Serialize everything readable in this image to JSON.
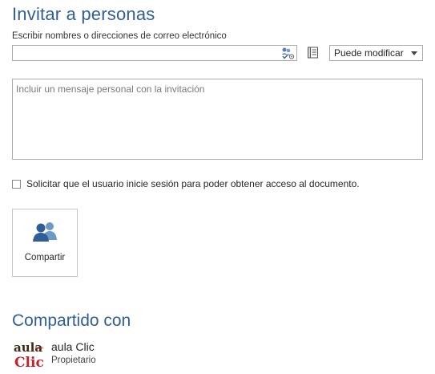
{
  "header": {
    "title": "Invitar a personas"
  },
  "invite": {
    "names_label": "Escribir nombres o direcciones de correo electrónico",
    "names_value": "",
    "permission_selected": "Puede modificar",
    "message_placeholder": "Incluir un mensaje personal con la invitación",
    "require_signin_label": "Solicitar que el usuario inicie sesión para poder obtener acceso al documento.",
    "require_signin_checked": false,
    "share_button_label": "Compartir"
  },
  "shared": {
    "title": "Compartido con",
    "people": [
      {
        "name": "aula Clic",
        "role": "Propietario",
        "avatar_text_top": "aula",
        "avatar_text_bottom": "Clic",
        "avatar_text_badge": ".com"
      }
    ]
  },
  "colors": {
    "accent": "#2f5f96",
    "border": "#ababab"
  },
  "icons": {
    "check_names": "check-names-icon",
    "address_book": "address-book-icon",
    "share": "share-people-icon"
  }
}
